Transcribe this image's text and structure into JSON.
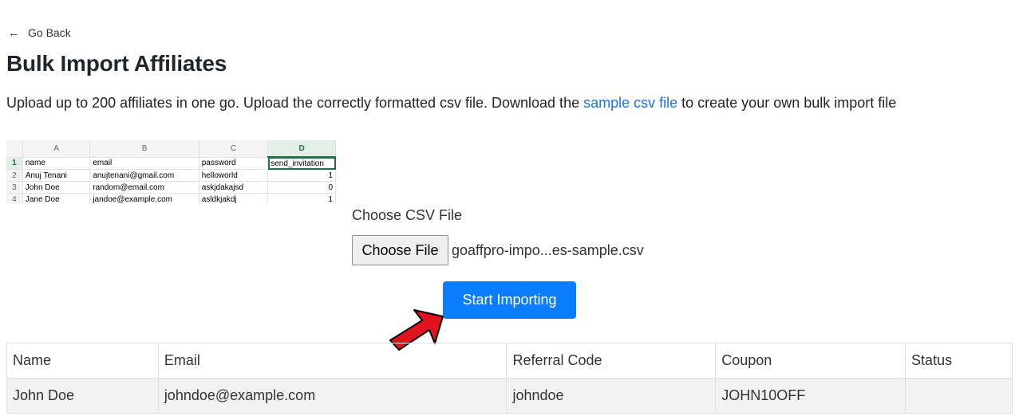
{
  "nav": {
    "back_label": "Go Back"
  },
  "page": {
    "title": "Bulk Import Affiliates",
    "description_before": "Upload up to 200 affiliates in one go. Upload the correctly formatted csv file. Download the ",
    "description_link": "sample csv file",
    "description_after": " to create your own bulk import file"
  },
  "sample_sheet": {
    "columns": [
      "A",
      "B",
      "C",
      "D"
    ],
    "rows": [
      {
        "n": "1",
        "cells": [
          "name",
          "email",
          "password",
          "send_invitation"
        ]
      },
      {
        "n": "2",
        "cells": [
          "Anuj Tenani",
          "anujtenani@gmail.com",
          "helloworld",
          "1"
        ]
      },
      {
        "n": "3",
        "cells": [
          "John Doe",
          "random@email.com",
          "askjdakajsd",
          "0"
        ]
      },
      {
        "n": "4",
        "cells": [
          "Jane Doe",
          "jandoe@example.com",
          "asldkjakdj",
          "1"
        ]
      }
    ]
  },
  "upload": {
    "label": "Choose CSV File",
    "button_label": "Choose File",
    "file_name": "goaffpro-impo...es-sample.csv",
    "start_label": "Start Importing"
  },
  "table": {
    "headers": [
      "Name",
      "Email",
      "Referral Code",
      "Coupon",
      "Status"
    ],
    "rows": [
      [
        "John Doe",
        "johndoe@example.com",
        "johndoe",
        "JOHN10OFF",
        ""
      ]
    ]
  },
  "colors": {
    "primary": "#0a7cff",
    "link": "#1a73e8",
    "pointer_arrow": "#e0141e",
    "sheet_accent": "#1e7145"
  },
  "icons": {
    "back": "left-arrow-icon",
    "pointer": "red-pointer-arrow-icon"
  }
}
